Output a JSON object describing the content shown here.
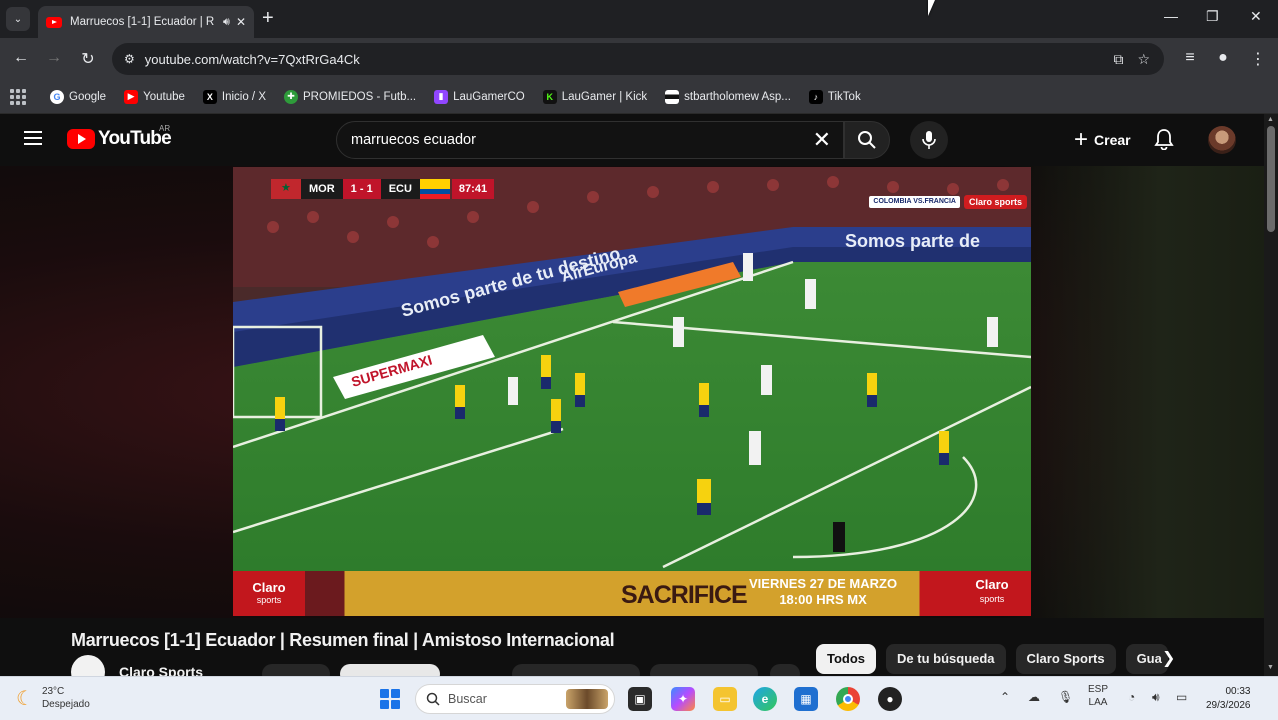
{
  "browser": {
    "tab": {
      "title": "Marruecos [1-1] Ecuador | R"
    },
    "url": "youtube.com/watch?v=7QxtRrGa4Ck",
    "bookmarks": [
      {
        "label": "Google",
        "icon": "google-icon",
        "color": "#4285f4"
      },
      {
        "label": "Youtube",
        "icon": "youtube-icon",
        "color": "#ff0000"
      },
      {
        "label": "Inicio / X",
        "icon": "x-icon",
        "color": "#000000"
      },
      {
        "label": "PROMIEDOS - Futb...",
        "icon": "promiedos-icon",
        "color": "#2e9b3a"
      },
      {
        "label": "LauGamerCO",
        "icon": "twitch-icon",
        "color": "#9146ff"
      },
      {
        "label": "LauGamer | Kick",
        "icon": "kick-icon",
        "color": "#53fc18"
      },
      {
        "label": "stbartholomew Asp...",
        "icon": "flag-icon",
        "color": "#222222"
      },
      {
        "label": "TikTok",
        "icon": "tiktok-icon",
        "color": "#000000"
      }
    ]
  },
  "youtube": {
    "logo_text": "YouTube",
    "region": "AR",
    "search_query": "marruecos ecuador",
    "create_label": "Crear"
  },
  "video": {
    "scorebug": {
      "home": "MOR",
      "score": "1 - 1",
      "away": "ECU",
      "clock": "87:41"
    },
    "corner_badge": "COLOMBIA VS.FRANCIA",
    "corner_brand": "Claro sports",
    "sponsor": {
      "left_brand": "Claro",
      "left_sub": "sports",
      "title": "SACRIFICE",
      "date_line1": "VIERNES 27 DE MARZO",
      "date_line2": "18:00 HRS MX",
      "right_brand": "Claro",
      "right_sub": "sports"
    },
    "title": "Marruecos [1-1] Ecuador | Resumen final | Amistoso Internacional",
    "channel": "Claro Sports"
  },
  "chips": [
    "Todos",
    "De tu búsqueda",
    "Claro Sports",
    "Gua"
  ],
  "taskbar": {
    "temperature": "23°C",
    "weather": "Despejado",
    "search_placeholder": "Buscar",
    "lang_top": "ESP",
    "lang_bottom": "LAA",
    "time": "00:33",
    "date": "29/3/2026"
  }
}
